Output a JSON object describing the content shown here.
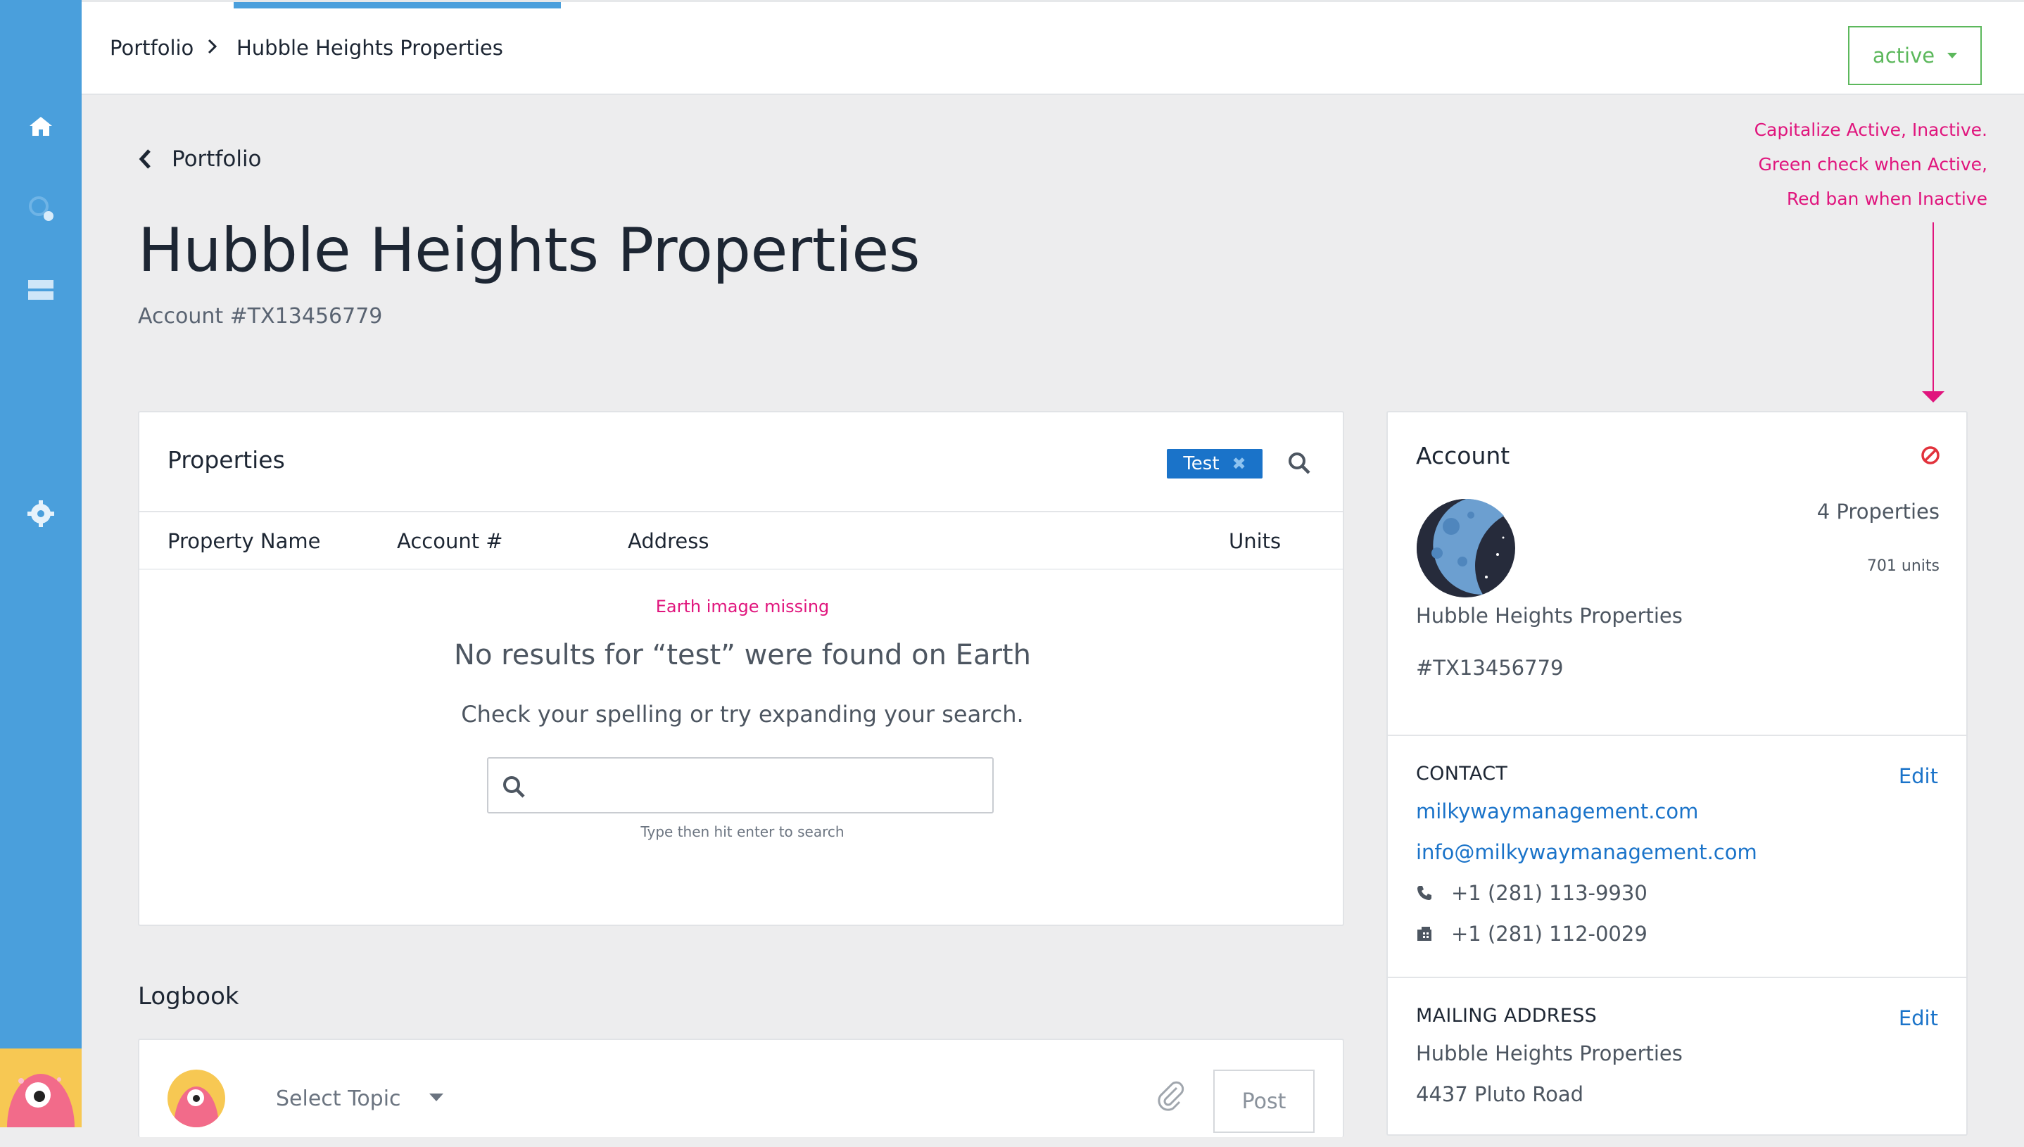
{
  "topbar": {
    "breadcrumb": [
      "Portfolio",
      "Hubble Heights Properties"
    ],
    "status_label": "active"
  },
  "annotations": {
    "status_note": [
      "Capitalize Active, Inactive.",
      "Green check when Active,",
      "Red ban when Inactive"
    ],
    "earth_note": "Earth image missing"
  },
  "page": {
    "back_label": "Portfolio",
    "title": "Hubble Heights Properties",
    "account_sub": "Account #TX13456779"
  },
  "properties": {
    "title": "Properties",
    "filter_chip": "Test",
    "columns": [
      "Property Name",
      "Account #",
      "Address",
      "Units"
    ],
    "empty_title": "No results for “test” were found on Earth",
    "empty_sub": "Check your spelling or try expanding your search.",
    "search_value": "",
    "search_hint": "Type then hit enter to search"
  },
  "logbook": {
    "title": "Logbook",
    "topic_placeholder": "Select Topic",
    "post_label": "Post"
  },
  "account": {
    "title": "Account",
    "properties_count": "4 Properties",
    "units_count": "701 units",
    "name": "Hubble Heights Properties",
    "number": "#TX13456779",
    "contact": {
      "heading": "CONTACT",
      "edit_label": "Edit",
      "website": "milkywaymanagement.com",
      "email": "info@milkywaymanagement.com",
      "phone": "+1 (281) 113-9930",
      "fax": "+1 (281) 112-0029"
    },
    "mailing": {
      "heading": "MAILING ADDRESS",
      "edit_label": "Edit",
      "line1": "Hubble Heights Properties",
      "line2": "4437 Pluto Road"
    }
  },
  "colors": {
    "sidebar": "#4a9fdc",
    "accent_blue": "#1a73c9",
    "status_green": "#5cb85c",
    "annotation_pink": "#e0157d",
    "ban_red": "#e2323c"
  },
  "icons": {
    "sidebar": [
      "home-icon",
      "analytics-icon",
      "layers-icon",
      "gear-icon"
    ],
    "status": "ban-icon"
  }
}
